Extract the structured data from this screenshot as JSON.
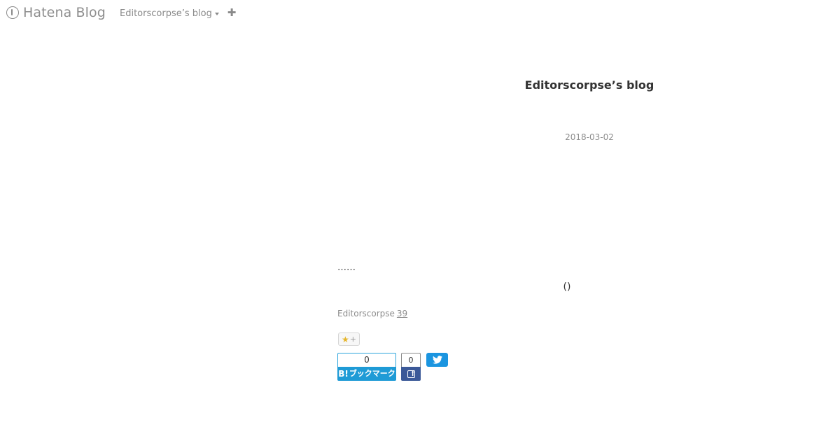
{
  "globalheader": {
    "logo_text": "Hatena Blog",
    "blog_menu_label": "Editorscorpse’s blog",
    "add_button_label": "✚"
  },
  "blog": {
    "title": "Editorscorpse’s blog"
  },
  "entry": {
    "date": "2018-03-02",
    "body_line1": "……",
    "body_line2": "()",
    "author": "Editorscorpse",
    "time_link": "39"
  },
  "star": {
    "glyph": "★",
    "plus": "+"
  },
  "share": {
    "hatena_bookmark": {
      "count": "0",
      "b_label": "B!",
      "label": "ブックマーク",
      "color": "#1f9bd6"
    },
    "facebook": {
      "count": "0",
      "color": "#3b5998"
    },
    "twitter": {
      "color": "#1b95e0"
    }
  },
  "icons": {
    "logo": "hatena-logo-icon",
    "caret": "caret-down-icon",
    "add": "plus-icon",
    "star": "star-icon",
    "facebook": "facebook-icon",
    "twitter": "twitter-bird-icon"
  }
}
